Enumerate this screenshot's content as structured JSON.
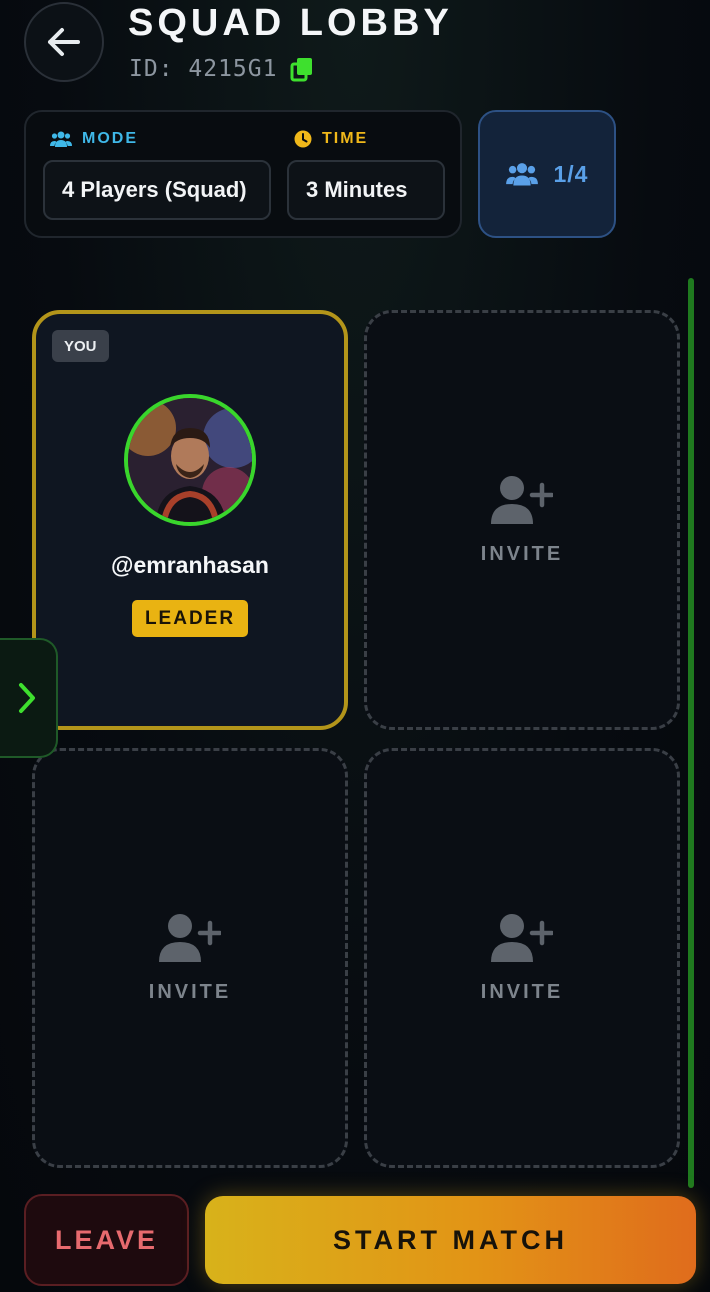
{
  "header": {
    "title": "SQUAD LOBBY",
    "lobby_id": "ID: 4215G1",
    "back_icon": "arrow-left-icon",
    "copy_icon": "copy-icon"
  },
  "settings": {
    "mode": {
      "label": "MODE",
      "value": "4 Players (Squad)",
      "icon": "users-icon"
    },
    "time": {
      "label": "TIME",
      "value": "3 Minutes",
      "icon": "clock-icon"
    }
  },
  "player_count": {
    "value": "1/4",
    "icon": "users-icon"
  },
  "slots": {
    "you": {
      "badge": "YOU",
      "username": "@emranhasan",
      "role": "LEADER"
    },
    "invite_label": "INVITE",
    "invite_icon": "user-plus-icon"
  },
  "side_tab": {
    "icon": "chevron-right-icon"
  },
  "footer": {
    "leave_label": "LEAVE",
    "start_label": "START MATCH"
  },
  "colors": {
    "accent_green": "#39d62c",
    "leader_gold": "#e9b312",
    "mode_blue": "#3fb8e8",
    "time_yellow": "#f0b81a",
    "count_blue": "#5aa0e8",
    "leave_red": "#e76a6e"
  }
}
